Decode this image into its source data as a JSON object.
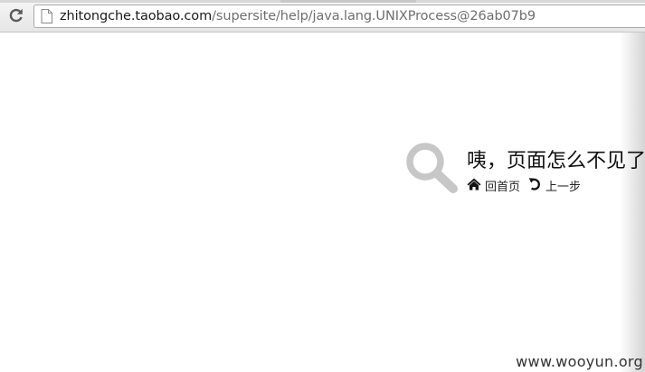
{
  "browser": {
    "url_host": "zhitongche.taobao.com",
    "url_path": "/supersite/help/java.lang.UNIXProcess@26ab07b9",
    "reload_icon": "reload-icon",
    "page_icon": "document-icon"
  },
  "error": {
    "icon": "search-icon",
    "headline": "咦，页面怎么不见了",
    "home_icon": "home-icon",
    "home_label": "回首页",
    "back_icon": "undo-icon",
    "back_label": "上一步"
  },
  "watermark": "www.wooyun.org",
  "colors": {
    "icon_gray": "#c7c7c7",
    "text_dark": "#111111"
  }
}
